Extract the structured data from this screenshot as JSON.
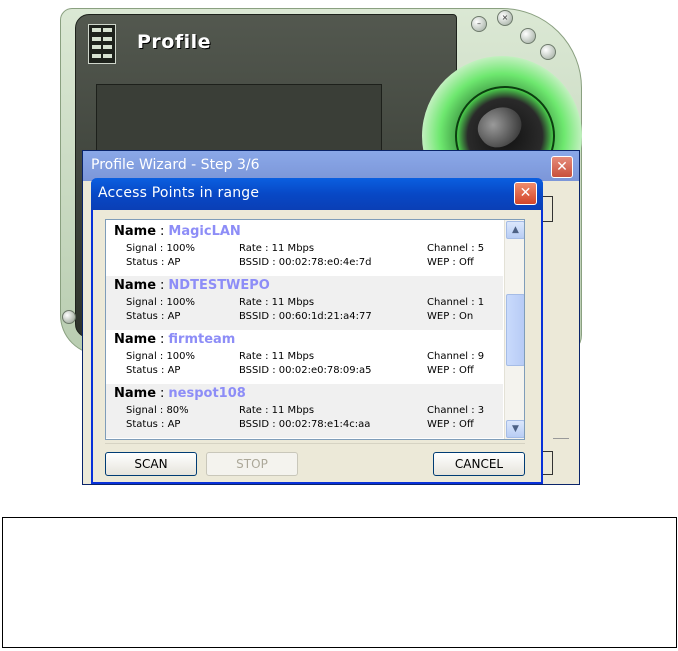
{
  "app": {
    "title": "Profile",
    "window_controls": [
      "minimize",
      "close",
      "extra"
    ]
  },
  "wizard": {
    "title": "Profile Wizard - Step 3/6",
    "close_glyph": "✕"
  },
  "ap_dialog": {
    "title": "Access Points in range",
    "close_glyph": "✕",
    "name_label": "Name",
    "separator": ":",
    "access_points": [
      {
        "name": "MagicLAN",
        "signal": "Signal : 100%",
        "rate": "Rate : 11 Mbps",
        "channel": "Channel : 5",
        "status": "Status : AP",
        "bssid": "BSSID : 00:02:78:e0:4e:7d",
        "wep": "WEP : Off"
      },
      {
        "name": "NDTESTWEPO",
        "signal": "Signal : 100%",
        "rate": "Rate : 11 Mbps",
        "channel": "Channel : 1",
        "status": "Status : AP",
        "bssid": "BSSID : 00:60:1d:21:a4:77",
        "wep": "WEP : On"
      },
      {
        "name": "firmteam",
        "signal": "Signal : 100%",
        "rate": "Rate : 11 Mbps",
        "channel": "Channel : 9",
        "status": "Status : AP",
        "bssid": "BSSID : 00:02:e0:78:09:a5",
        "wep": "WEP : Off"
      },
      {
        "name": "nespot108",
        "signal": "Signal : 80%",
        "rate": "Rate : 11 Mbps",
        "channel": "Channel : 3",
        "status": "Status : AP",
        "bssid": "BSSID : 00:02:78:e1:4c:aa",
        "wep": "WEP : Off"
      }
    ],
    "scroll_up_glyph": "▲",
    "scroll_down_glyph": "▼",
    "buttons": {
      "scan": "SCAN",
      "stop": "STOP",
      "cancel": "CANCEL"
    }
  },
  "colors": {
    "ap_name": "#8d8df7",
    "dialog_title_bar": "#0848c6",
    "wizard_title_bar": "#8aa8e8",
    "dial_glow": "#6ee86f"
  }
}
